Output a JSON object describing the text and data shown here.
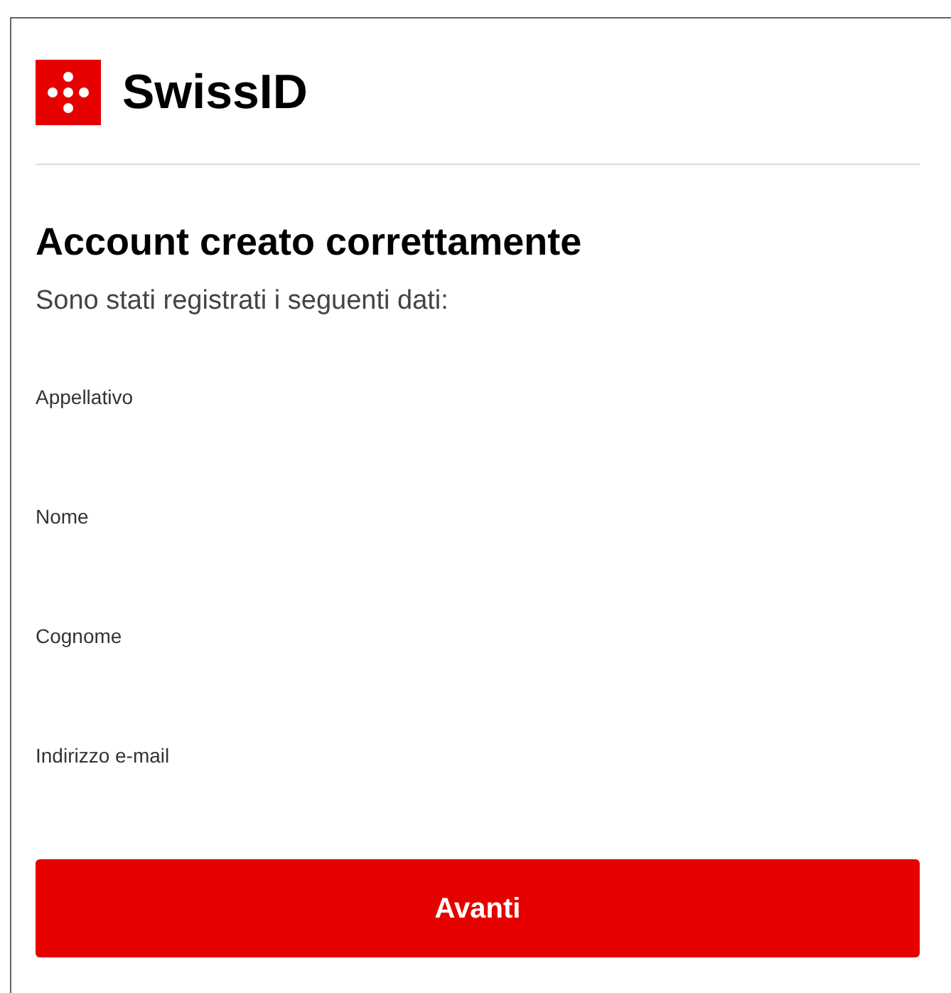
{
  "brand": "SwissID",
  "title": "Account creato correttamente",
  "subtitle": "Sono stati registrati i seguenti dati:",
  "fields": [
    {
      "label": "Appellativo"
    },
    {
      "label": "Nome"
    },
    {
      "label": "Cognome"
    },
    {
      "label": "Indirizzo e-mail"
    }
  ],
  "button": "Avanti"
}
